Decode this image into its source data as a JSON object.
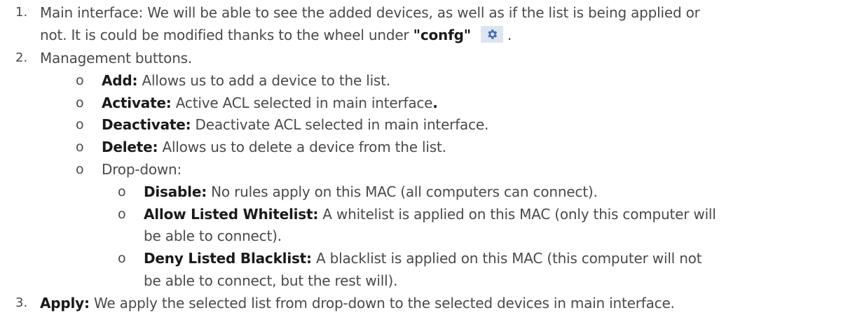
{
  "items": [
    {
      "number": "1.",
      "line1": "Main interface: We will be able to see the added devices, as well as if the list is being applied or",
      "line2_pre": "not. It is could be modified thanks to the wheel under ",
      "line2_bold": "\"confg\"",
      "line2_post": ".",
      "icon": "gear-icon"
    },
    {
      "number": "2.",
      "text": "Management buttons.",
      "bullets": [
        {
          "marker": "o",
          "label": "Add:",
          "text": " Allows us to add a device to the list."
        },
        {
          "marker": "o",
          "label": "Activate:",
          "text": " Active ACL selected in main interface",
          "bold_end": "."
        },
        {
          "marker": "o",
          "label": "Deactivate:",
          "text": " Deactivate ACL selected in main interface."
        },
        {
          "marker": "o",
          "label": "Delete:",
          "text": " Allows us to delete a device from the list."
        },
        {
          "marker": "o",
          "text": "Drop-down:"
        }
      ],
      "sub_bullets": [
        {
          "marker": "o",
          "label": "Disable:",
          "text": " No rules apply on this MAC (all computers can connect)."
        },
        {
          "marker": "o",
          "label": "Allow Listed Whitelist:",
          "text": " A whitelist is applied on this MAC (only this computer will",
          "cont": "be able to connect)."
        },
        {
          "marker": "o",
          "label": "Deny Listed Blacklist:",
          "text": " A blacklist is applied on this MAC (this computer will not",
          "cont": "be able to connect, but the rest will)."
        }
      ]
    },
    {
      "number": "3.",
      "label": "Apply:",
      "text": " We apply the selected list from drop-down to the selected devices in main interface."
    }
  ],
  "colors": {
    "text": "#4a4a4a",
    "bold": "#1a1a1a",
    "icon_bg": "#dfe5ee",
    "icon": "#3d6fb6"
  }
}
